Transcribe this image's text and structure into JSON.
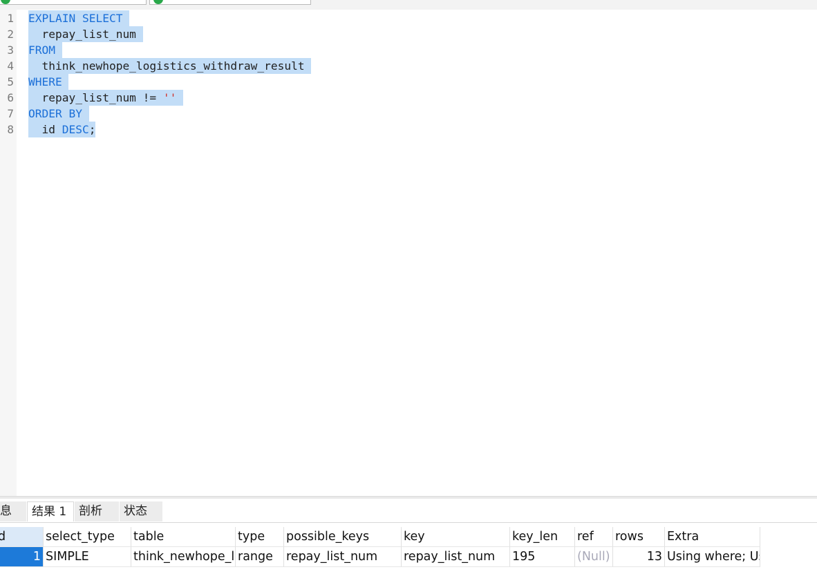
{
  "editor": {
    "lines": [
      {
        "number": "1",
        "parts": [
          {
            "text": "EXPLAIN SELECT",
            "cls": "kw"
          },
          {
            "text": " ",
            "cls": ""
          }
        ]
      },
      {
        "number": "2",
        "parts": [
          {
            "text": "  repay_list_num ",
            "cls": ""
          }
        ]
      },
      {
        "number": "3",
        "parts": [
          {
            "text": "FROM",
            "cls": "kw"
          },
          {
            "text": " ",
            "cls": ""
          }
        ]
      },
      {
        "number": "4",
        "parts": [
          {
            "text": "  think_newhope_logistics_withdraw_result ",
            "cls": ""
          }
        ]
      },
      {
        "number": "5",
        "parts": [
          {
            "text": "WHERE",
            "cls": "kw"
          },
          {
            "text": " ",
            "cls": ""
          }
        ]
      },
      {
        "number": "6",
        "parts": [
          {
            "text": "  repay_list_num != ",
            "cls": ""
          },
          {
            "text": "''",
            "cls": "str"
          },
          {
            "text": " ",
            "cls": ""
          }
        ]
      },
      {
        "number": "7",
        "parts": [
          {
            "text": "ORDER BY",
            "cls": "kw"
          },
          {
            "text": " ",
            "cls": ""
          }
        ]
      },
      {
        "number": "8",
        "parts": [
          {
            "text": "  id ",
            "cls": ""
          },
          {
            "text": "DESC",
            "cls": "kw"
          },
          {
            "text": ";",
            "cls": ""
          }
        ]
      }
    ]
  },
  "tabs": {
    "info": "息",
    "result": "结果 1",
    "profile": "剖析",
    "status": "状态"
  },
  "grid": {
    "columns": [
      {
        "key": "id",
        "label": "d"
      },
      {
        "key": "select_type",
        "label": "select_type"
      },
      {
        "key": "table",
        "label": "table"
      },
      {
        "key": "type",
        "label": "type"
      },
      {
        "key": "possible_keys",
        "label": "possible_keys"
      },
      {
        "key": "key",
        "label": "key"
      },
      {
        "key": "key_len",
        "label": "key_len"
      },
      {
        "key": "ref",
        "label": "ref"
      },
      {
        "key": "rows",
        "label": "rows"
      },
      {
        "key": "extra",
        "label": "Extra"
      }
    ],
    "rows": [
      {
        "id": "1",
        "select_type": "SIMPLE",
        "table": "think_newhope_logistics_withdraw_result",
        "type": "range",
        "possible_keys": "repay_list_num",
        "key": "repay_list_num",
        "key_len": "195",
        "ref": "(Null)",
        "rows": "13",
        "extra": "Using where; Using filesort"
      }
    ]
  }
}
